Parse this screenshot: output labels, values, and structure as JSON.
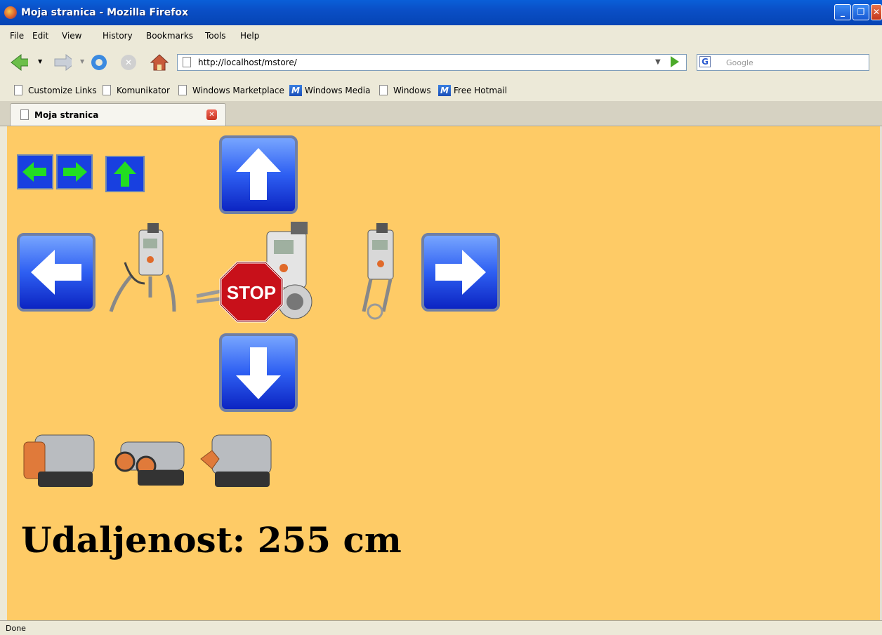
{
  "window": {
    "title": "Moja stranica - Mozilla Firefox"
  },
  "menu": [
    "File",
    "Edit",
    "View",
    "History",
    "Bookmarks",
    "Tools",
    "Help"
  ],
  "nav": {
    "url": "http://localhost/mstore/",
    "search_placeholder": "Google"
  },
  "bookmarks": [
    "Customize Links",
    "Komunikator",
    "Windows Marketplace",
    "Windows Media",
    "Windows",
    "Free Hotmail"
  ],
  "tab": {
    "label": "Moja stranica"
  },
  "page": {
    "stop_label": "STOP",
    "distance_text": "Udaljenost: 255 cm"
  },
  "status": {
    "text": "Done"
  },
  "colors": {
    "page_background": "#fecb66",
    "button_blue": "#2a5df0",
    "arrow_green": "#22dd22",
    "stop_red": "#c8101a"
  }
}
